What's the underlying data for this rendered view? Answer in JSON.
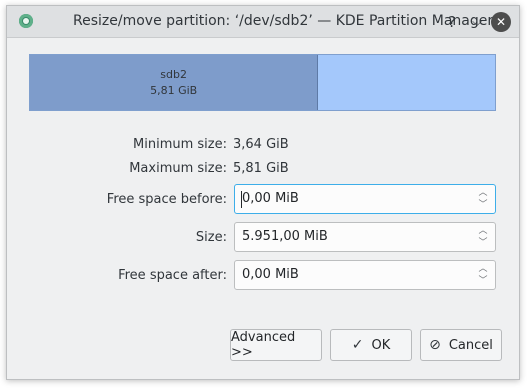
{
  "window": {
    "title": "Resize/move partition: ‘/dev/sdb2’ — KDE Partition Manager",
    "help_glyph": "?",
    "minimize_glyph": "⌵",
    "close_glyph": "✕"
  },
  "partition": {
    "name": "sdb2",
    "size": "5,81 GiB",
    "used_fraction": 0.62
  },
  "info": {
    "min_label": "Minimum size:",
    "min_value": "3,64 GiB",
    "max_label": "Maximum size:",
    "max_value": "5,81 GiB"
  },
  "fields": {
    "free_before_label": "Free space before:",
    "free_before_value": "0,00 MiB",
    "size_label": "Size:",
    "size_value": "5.951,00 MiB",
    "free_after_label": "Free space after:",
    "free_after_value": "0,00 MiB"
  },
  "buttons": {
    "advanced": "Advanced >>",
    "ok": "OK",
    "cancel": "Cancel"
  },
  "colors": {
    "free_space": "#a4c8fb",
    "used_space": "#7e9ccb",
    "focus": "#3daee9"
  }
}
